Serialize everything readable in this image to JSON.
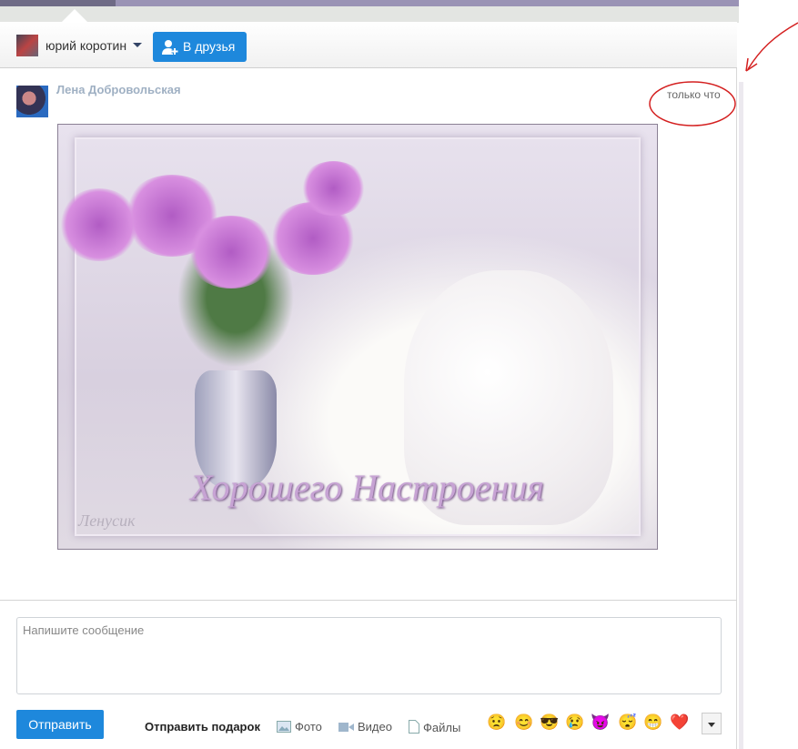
{
  "header": {
    "user_name": "юрий коротин",
    "add_friend_label": "В друзья"
  },
  "message": {
    "author": "Лена Добровольская",
    "time": "только что",
    "image": {
      "caption": "Хорошего Настроения",
      "signature": "Ленусик"
    }
  },
  "composer": {
    "placeholder": "Напишите сообщение",
    "send_label": "Отправить",
    "gift_label": "Отправить подарок",
    "photo_label": "Фото",
    "video_label": "Видео",
    "files_label": "Файлы",
    "emojis": [
      "😟",
      "😊",
      "😎",
      "😢",
      "😈",
      "😴",
      "😁",
      "❤️"
    ]
  },
  "colors": {
    "accent": "#1e88dc",
    "annotation": "#d42020"
  }
}
